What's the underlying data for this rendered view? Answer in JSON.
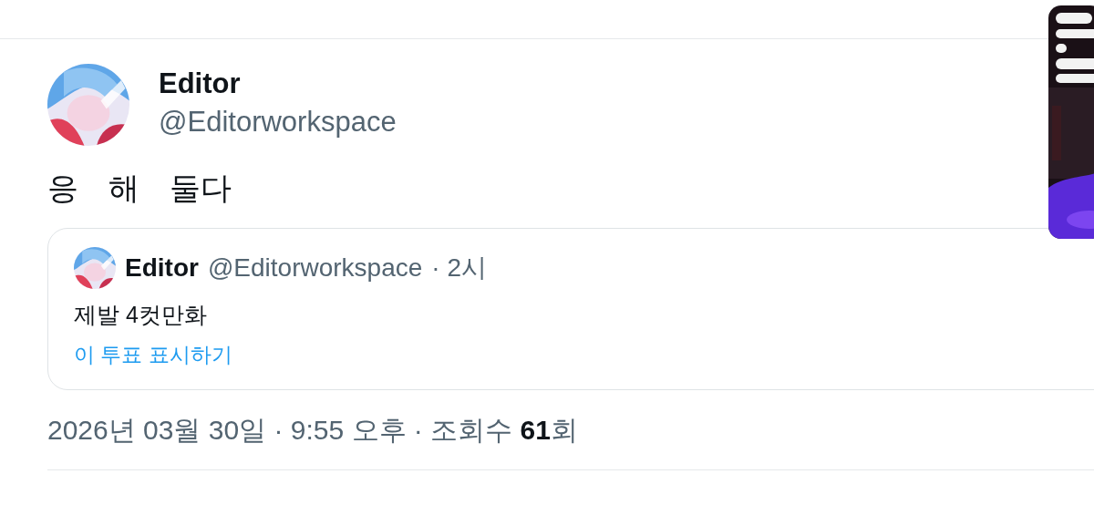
{
  "post": {
    "author": {
      "name": "Editor",
      "handle": "@Editorworkspace"
    },
    "text": "응 해 둘다",
    "quote": {
      "author": {
        "name": "Editor",
        "handle": "@Editorworkspace"
      },
      "time": "· 2시",
      "text": "제발 4컷만화",
      "link": "이 투표 표시하기"
    },
    "meta": "2026년 03월 30일 · 9:55 오후 · 조회수 **61**회"
  }
}
